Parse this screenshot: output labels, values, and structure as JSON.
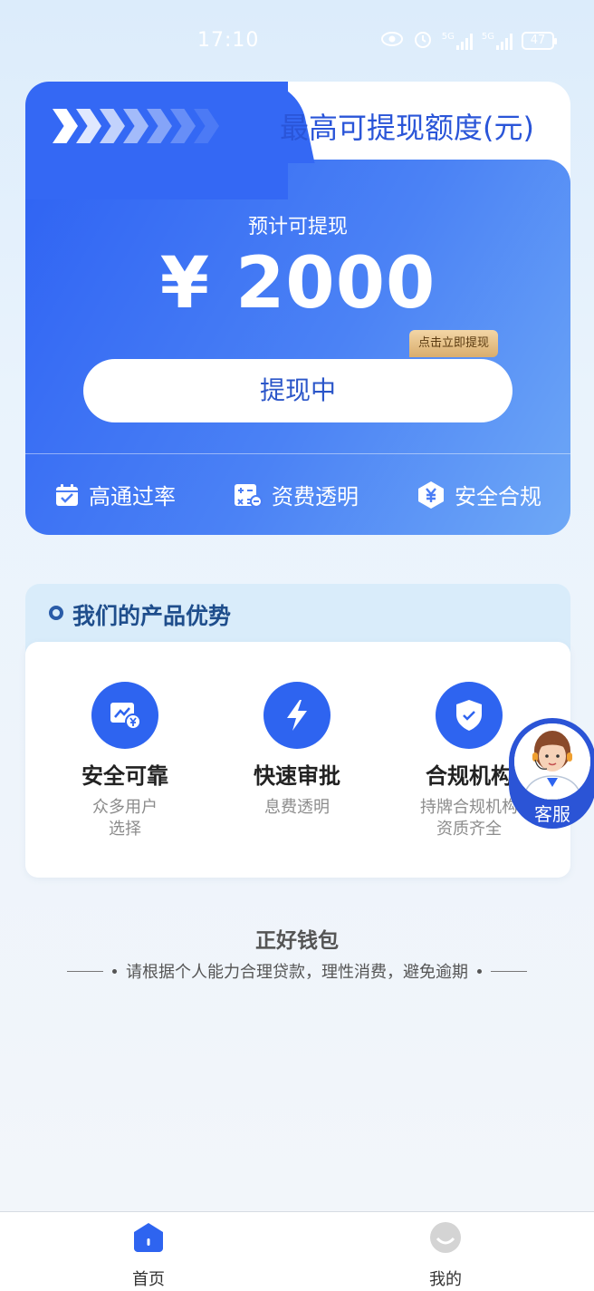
{
  "status_bar": {
    "time": "17:10",
    "network1": "5G",
    "network2": "5G",
    "battery": "47"
  },
  "main_card": {
    "title": "最高可提现额度(元)",
    "estimate_label": "预计可提现",
    "amount": "¥ 2000",
    "withdraw_button": "提现中",
    "tooltip": "点击立即提现",
    "features": [
      {
        "label": "高通过率",
        "icon": "calendar-check-icon"
      },
      {
        "label": "资费透明",
        "icon": "calculator-icon"
      },
      {
        "label": "安全合规",
        "icon": "yuan-hexagon-icon"
      }
    ]
  },
  "advantages": {
    "title": "我们的产品优势",
    "items": [
      {
        "name": "安全可靠",
        "desc": "众多用户\n选择",
        "icon": "chart-yuan-icon"
      },
      {
        "name": "快速审批",
        "desc": "息费透明",
        "icon": "lightning-icon"
      },
      {
        "name": "合规机构",
        "desc": "持牌合规机构\n资质齐全",
        "icon": "shield-check-icon"
      }
    ]
  },
  "service": {
    "label": "客服"
  },
  "footer": {
    "brand": "正好钱包",
    "slogan": "请根据个人能力合理贷款，理性消费，避免逾期"
  },
  "bottom_nav": {
    "items": [
      {
        "label": "首页",
        "icon": "home-icon",
        "active": true
      },
      {
        "label": "我的",
        "icon": "profile-icon",
        "active": false
      }
    ]
  },
  "colors": {
    "primary": "#3468f4",
    "accent_title": "#2a55d8",
    "tooltip_gold": "#d9ad6d"
  }
}
